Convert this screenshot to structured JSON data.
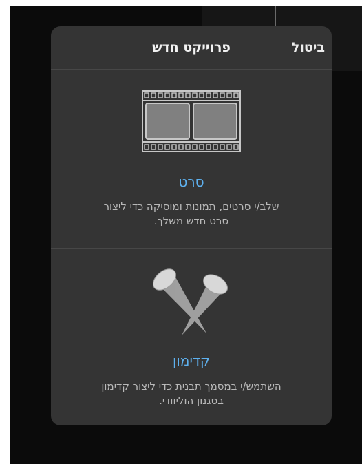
{
  "dialog": {
    "title": "פרוייקט חדש",
    "cancel_label": "ביטול"
  },
  "options": [
    {
      "title": "סרט",
      "description": "שלב/י סרטים, תמונות ומוסיקה כדי ליצור סרט חדש משלך.",
      "icon": "film-strip-icon"
    },
    {
      "title": "קדימון",
      "description": "השתמש/י במסמך תבנית כדי ליצור קדימון בסגנון הוליוודי.",
      "icon": "spotlights-icon"
    }
  ],
  "colors": {
    "accent": "#5eb1ef",
    "dialog_background": "#343434",
    "screen_background": "#0b0b0b"
  }
}
